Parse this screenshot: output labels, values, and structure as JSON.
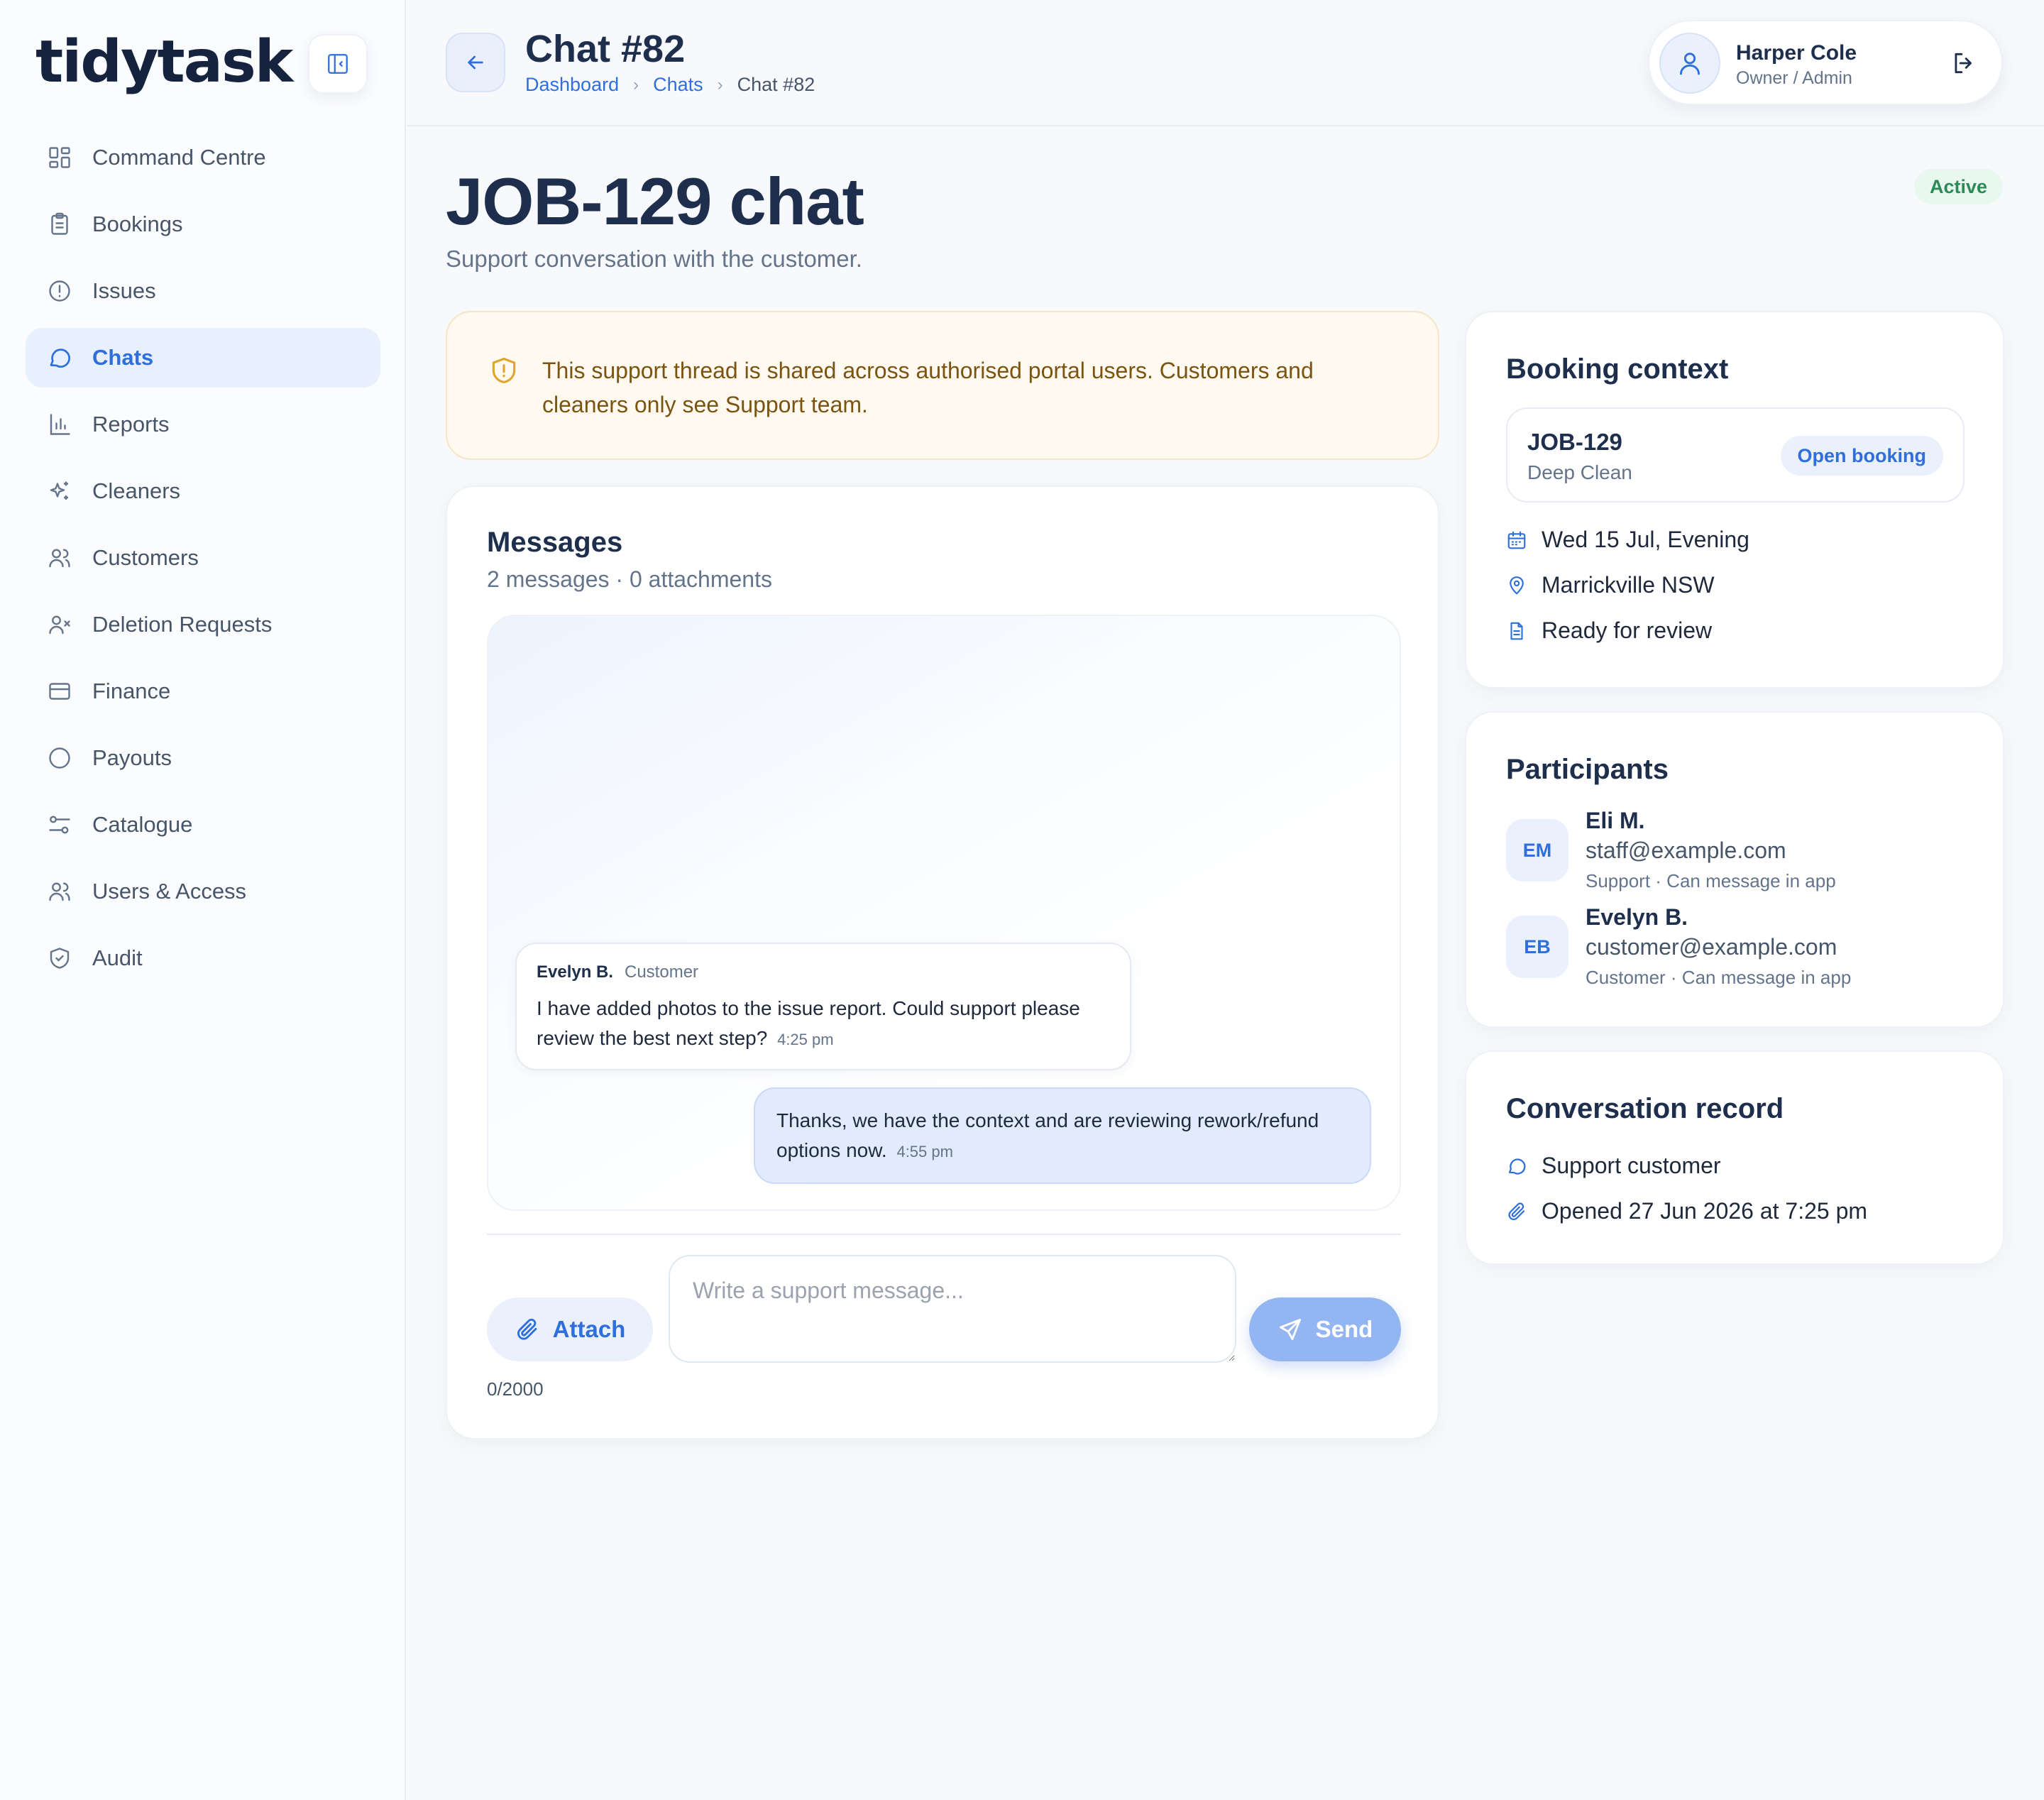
{
  "app": {
    "logo": "tidytask"
  },
  "sidebar": {
    "items": [
      {
        "label": "Command Centre",
        "icon": "grid-icon"
      },
      {
        "label": "Bookings",
        "icon": "clipboard-icon"
      },
      {
        "label": "Issues",
        "icon": "alert-circle-icon"
      },
      {
        "label": "Chats",
        "icon": "chat-bubble-icon",
        "active": true
      },
      {
        "label": "Reports",
        "icon": "bar-chart-icon"
      },
      {
        "label": "Cleaners",
        "icon": "sparkles-icon"
      },
      {
        "label": "Customers",
        "icon": "users-icon"
      },
      {
        "label": "Deletion Requests",
        "icon": "user-x-icon"
      },
      {
        "label": "Finance",
        "icon": "credit-card-icon"
      },
      {
        "label": "Payouts",
        "icon": "circle-icon"
      },
      {
        "label": "Catalogue",
        "icon": "sliders-icon"
      },
      {
        "label": "Users & Access",
        "icon": "users-icon"
      },
      {
        "label": "Audit",
        "icon": "shield-check-icon"
      }
    ]
  },
  "header": {
    "title": "Chat #82",
    "breadcrumb": [
      {
        "label": "Dashboard"
      },
      {
        "label": "Chats"
      },
      {
        "label": "Chat #82"
      }
    ],
    "user": {
      "name": "Harper Cole",
      "role": "Owner / Admin"
    }
  },
  "page": {
    "title": "JOB-129 chat",
    "subtitle": "Support conversation with the customer.",
    "status": "Active",
    "status_color": "#2d8a57"
  },
  "notice": {
    "text": "This support thread is shared across authorised portal users. Customers and cleaners only see Support team."
  },
  "messages": {
    "title": "Messages",
    "meta": "2 messages · 0 attachments",
    "thread": [
      {
        "sender": "Evelyn B.",
        "role": "Customer",
        "text": "I have added photos to the issue report. Could support please review the best next step?",
        "time": "4:25 pm"
      },
      {
        "text": "Thanks, we have the context and are reviewing rework/refund options now.",
        "time": "4:55 pm"
      }
    ],
    "composer": {
      "attach_label": "Attach",
      "placeholder": "Write a support message...",
      "value": "",
      "send_label": "Send",
      "char_count": "0/2000"
    }
  },
  "booking_context": {
    "title": "Booking context",
    "job_id": "JOB-129",
    "job_type": "Deep Clean",
    "open_label": "Open booking",
    "date": "Wed 15 Jul, Evening",
    "location": "Marrickville NSW",
    "status": "Ready for review"
  },
  "participants": {
    "title": "Participants",
    "list": [
      {
        "initials": "EM",
        "name": "Eli M.",
        "email": "staff@example.com",
        "role": "Support · Can message in app"
      },
      {
        "initials": "EB",
        "name": "Evelyn B.",
        "email": "customer@example.com",
        "role": "Customer · Can message in app"
      }
    ]
  },
  "conversation_record": {
    "title": "Conversation record",
    "type": "Support customer",
    "opened": "Opened 27 Jun 2026 at 7:25 pm"
  },
  "colors": {
    "accent": "#2f6fdb",
    "notice_bg": "#fff9ef",
    "notice_text": "#7a5410"
  }
}
